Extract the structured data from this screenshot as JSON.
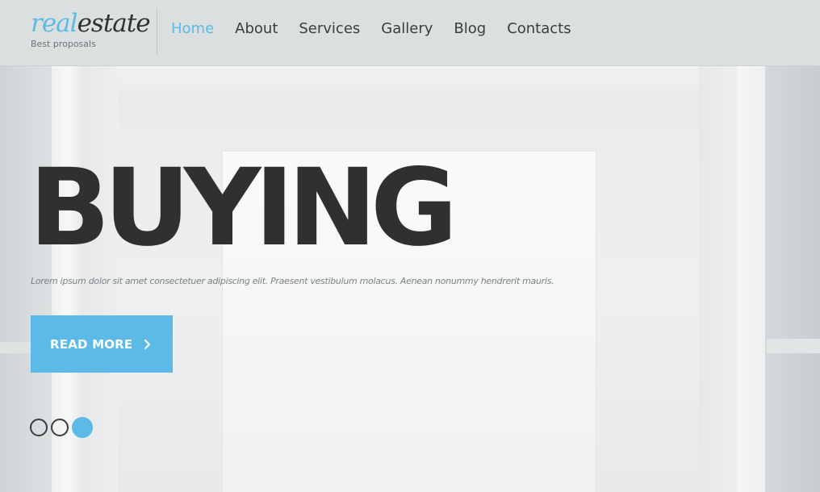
{
  "brand": {
    "name_accent": "real",
    "name_main": "estate",
    "tagline": "Best proposals"
  },
  "nav": {
    "items": [
      {
        "label": "Home",
        "active": true
      },
      {
        "label": "About",
        "active": false
      },
      {
        "label": "Services",
        "active": false
      },
      {
        "label": "Gallery",
        "active": false
      },
      {
        "label": "Blog",
        "active": false
      },
      {
        "label": "Contacts",
        "active": false
      }
    ]
  },
  "hero": {
    "title": "BUYING",
    "subtitle": "Lorem ipsum dolor sit amet consectetuer adipiscing elit. Praesent vestibulum molacus. Aenean nonummy hendrerit mauris.",
    "cta_label": "READ MORE",
    "cta_icon": "chevron-right-icon"
  },
  "slider": {
    "slide_count": 3,
    "active_index": 2
  },
  "colors": {
    "accent": "#5cbbe6",
    "text_dark": "#2e3032",
    "header_bg": "#dcdfe0"
  }
}
